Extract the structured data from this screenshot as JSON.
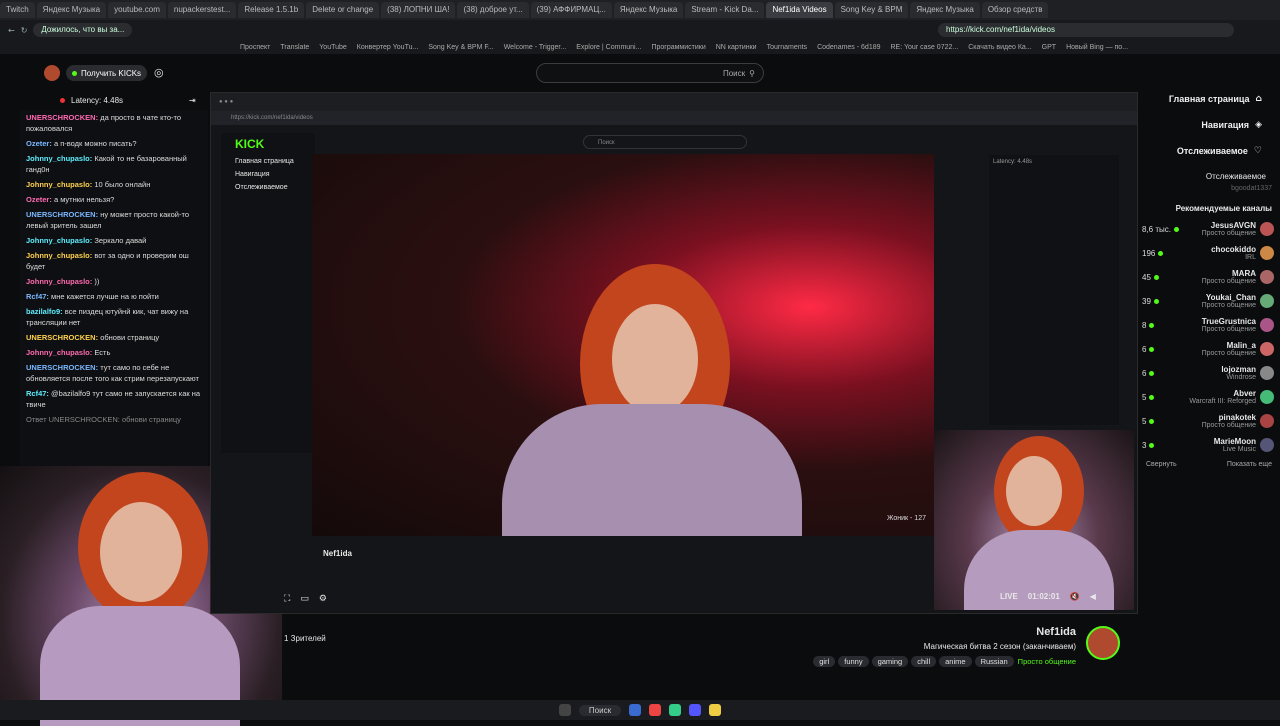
{
  "tabs": [
    "Twitch",
    "Яндекс Музыка",
    "youtube.com",
    "nupackerstest...",
    "Release 1.5.1b",
    "Delete or change",
    "(38) ЛОПНИ ША!",
    "(38) доброе ут...",
    "(39) АФФИРМАЦ...",
    "Яндекс Музыка",
    "Stream - Kick Da...",
    "Nef1ida Videos",
    "Song Key & BPM",
    "Яндекс Музыка",
    "Обзор средств"
  ],
  "active_tab": "Nef1ida Videos",
  "address": "https://kick.com/nef1ida/videos",
  "profile_chip": "Дожилось, что вы за...",
  "bookmarks": [
    "Проспект",
    "Translate",
    "YouTube",
    "Конвертер YouTu...",
    "Song Key & BPM F...",
    "Welcome - Trigger...",
    "Explore | Communi...",
    "Программистики",
    "NN картинки",
    "Tournaments",
    "Codenames - 6d189",
    "RE: Your case 0722...",
    "Скачать видео Ка...",
    "GPT",
    "Новый Bing — по..."
  ],
  "header": {
    "get_kicks": "Получить KICKs",
    "search_placeholder": "Поиск",
    "logo": "KICK"
  },
  "chat": {
    "latency": "Latency: 4.48s",
    "messages": [
      {
        "user": "UNERSCHROCKEN:",
        "text": "да просто в чате кто-то пожаловался"
      },
      {
        "user": "Ozeter:",
        "text": "а п-водк можно писать?"
      },
      {
        "user": "Johnny_chupaslo:",
        "text": "Какой то не базарованный ганд0н"
      },
      {
        "user": "Johnny_chupaslo:",
        "text": "10 было онлайн"
      },
      {
        "user": "Ozeter:",
        "text": "а мутнки нельзя?"
      },
      {
        "user": "UNERSCHROCKEN:",
        "text": "ну может просто какой-то левый зритель зашел"
      },
      {
        "user": "Johnny_chupaslo:",
        "text": "Зеркало давай"
      },
      {
        "user": "Johnny_chupaslo:",
        "text": "вот за одно и проверим ош будет"
      },
      {
        "user": "Johnny_chupaslo:",
        "text": "))"
      },
      {
        "user": "Rcf47:",
        "text": "мне кажется лучше на ю пойти"
      },
      {
        "user": "bazilalfo9:",
        "text": "все пиздец ютуйнй кик, чат вижу на трансляции нет"
      },
      {
        "user": "UNERSCHROCKEN:",
        "text": "обнови страницу"
      },
      {
        "user": "Johnny_chupaslo:",
        "text": "Есть"
      },
      {
        "user": "UNERSCHROCKEN:",
        "text": "тут само по себе не обновляется после того как стрим перезапускают"
      },
      {
        "user": "Rcf47:",
        "text": "@bazilalfo9 тут само не запускается как на твиче"
      }
    ],
    "reply_note": "Ответ UNERSCHROCKEN: обнови страницу"
  },
  "sidebar": {
    "nav": [
      "Главная страница",
      "Навигация",
      "Отслеживаемое"
    ],
    "following_label": "Отслеживаемое",
    "following_user": "bgoodat1337",
    "recommended_title": "Рекомендуемые каналы",
    "channels": [
      {
        "name": "JesusAVGN",
        "cat": "Просто общение",
        "count": "8,6 тыс."
      },
      {
        "name": "chocokiddo",
        "cat": "IRL",
        "count": "196"
      },
      {
        "name": "MARA",
        "cat": "Просто общение",
        "count": "45"
      },
      {
        "name": "Youkai_Chan",
        "cat": "Просто общение",
        "count": "39"
      },
      {
        "name": "TrueGrustnica",
        "cat": "Просто общение",
        "count": "8"
      },
      {
        "name": "Malin_a",
        "cat": "Просто общение",
        "count": "6"
      },
      {
        "name": "lojozman",
        "cat": "Windrose",
        "count": "6"
      },
      {
        "name": "Abver",
        "cat": "Warcraft III: Reforged",
        "count": "5"
      },
      {
        "name": "pinakotek",
        "cat": "Просто общение",
        "count": "5"
      },
      {
        "name": "MarieMoon",
        "cat": "Live Music",
        "count": "3"
      }
    ],
    "collapse": "Свернуть",
    "show_more": "Показать еще"
  },
  "stream": {
    "name": "Nef1ida",
    "title": "Магическая битва 2 сезон (заканчиваем)",
    "category": "Просто общение",
    "tags": [
      "Russian",
      "anime",
      "chill",
      "gaming",
      "funny",
      "girl"
    ],
    "viewers": "1 Зрителей",
    "time": "01:02:01",
    "live": "LIVE",
    "overlay_text": "Жоник - 127"
  },
  "taskbar": {
    "search": "Поиск"
  },
  "colors": {
    "accent": "#53fc18",
    "bg": "#0b0c0e",
    "panel": "#18191c"
  }
}
